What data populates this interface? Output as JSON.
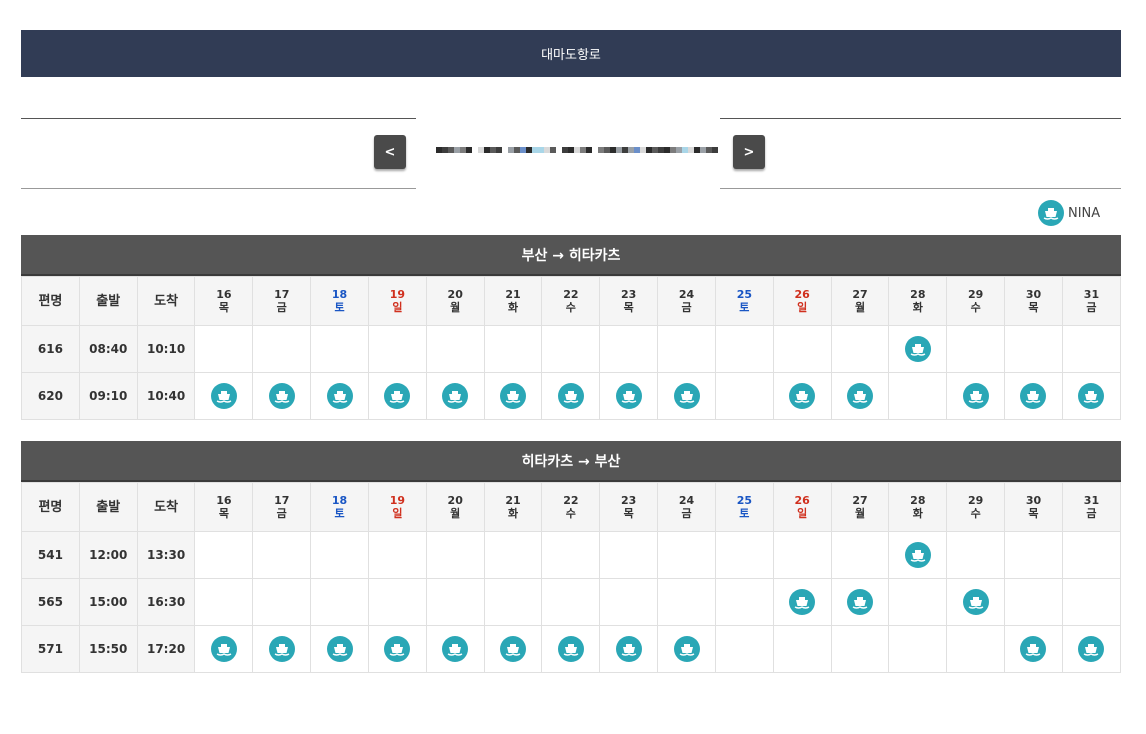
{
  "header": {
    "title": "대마도항로"
  },
  "nav": {
    "prev_label": "<",
    "next_label": ">"
  },
  "legend": {
    "label": "NINA",
    "icon": "ship-icon"
  },
  "colors": {
    "header_bg": "#313c55",
    "route_bg": "#555555",
    "icon": "#2aa7b6",
    "saturday": "#1a56c4",
    "sunday": "#d0301e"
  },
  "table_headers": {
    "service": "편명",
    "depart": "출발",
    "arrive": "도착"
  },
  "days": [
    {
      "date": "16",
      "dow": "목",
      "type": "weekday"
    },
    {
      "date": "17",
      "dow": "금",
      "type": "weekday"
    },
    {
      "date": "18",
      "dow": "토",
      "type": "sat"
    },
    {
      "date": "19",
      "dow": "일",
      "type": "sun"
    },
    {
      "date": "20",
      "dow": "월",
      "type": "weekday"
    },
    {
      "date": "21",
      "dow": "화",
      "type": "weekday"
    },
    {
      "date": "22",
      "dow": "수",
      "type": "weekday"
    },
    {
      "date": "23",
      "dow": "목",
      "type": "weekday"
    },
    {
      "date": "24",
      "dow": "금",
      "type": "weekday"
    },
    {
      "date": "25",
      "dow": "토",
      "type": "sat"
    },
    {
      "date": "26",
      "dow": "일",
      "type": "sun"
    },
    {
      "date": "27",
      "dow": "월",
      "type": "weekday"
    },
    {
      "date": "28",
      "dow": "화",
      "type": "weekday"
    },
    {
      "date": "29",
      "dow": "수",
      "type": "weekday"
    },
    {
      "date": "30",
      "dow": "목",
      "type": "weekday"
    },
    {
      "date": "31",
      "dow": "금",
      "type": "weekday"
    }
  ],
  "routes": [
    {
      "title": "부산 → 히타카츠",
      "rows": [
        {
          "service": "616",
          "depart": "08:40",
          "arrive": "10:10",
          "sail": [
            0,
            0,
            0,
            0,
            0,
            0,
            0,
            0,
            0,
            0,
            0,
            0,
            1,
            0,
            0,
            0
          ]
        },
        {
          "service": "620",
          "depart": "09:10",
          "arrive": "10:40",
          "sail": [
            1,
            1,
            1,
            1,
            1,
            1,
            1,
            1,
            1,
            0,
            1,
            1,
            0,
            1,
            1,
            1
          ]
        }
      ]
    },
    {
      "title": "히타카츠 → 부산",
      "rows": [
        {
          "service": "541",
          "depart": "12:00",
          "arrive": "13:30",
          "sail": [
            0,
            0,
            0,
            0,
            0,
            0,
            0,
            0,
            0,
            0,
            0,
            0,
            1,
            0,
            0,
            0
          ]
        },
        {
          "service": "565",
          "depart": "15:00",
          "arrive": "16:30",
          "sail": [
            0,
            0,
            0,
            0,
            0,
            0,
            0,
            0,
            0,
            0,
            1,
            1,
            0,
            1,
            0,
            0
          ]
        },
        {
          "service": "571",
          "depart": "15:50",
          "arrive": "17:20",
          "sail": [
            1,
            1,
            1,
            1,
            1,
            1,
            1,
            1,
            1,
            0,
            0,
            0,
            0,
            0,
            1,
            1
          ]
        }
      ]
    }
  ]
}
